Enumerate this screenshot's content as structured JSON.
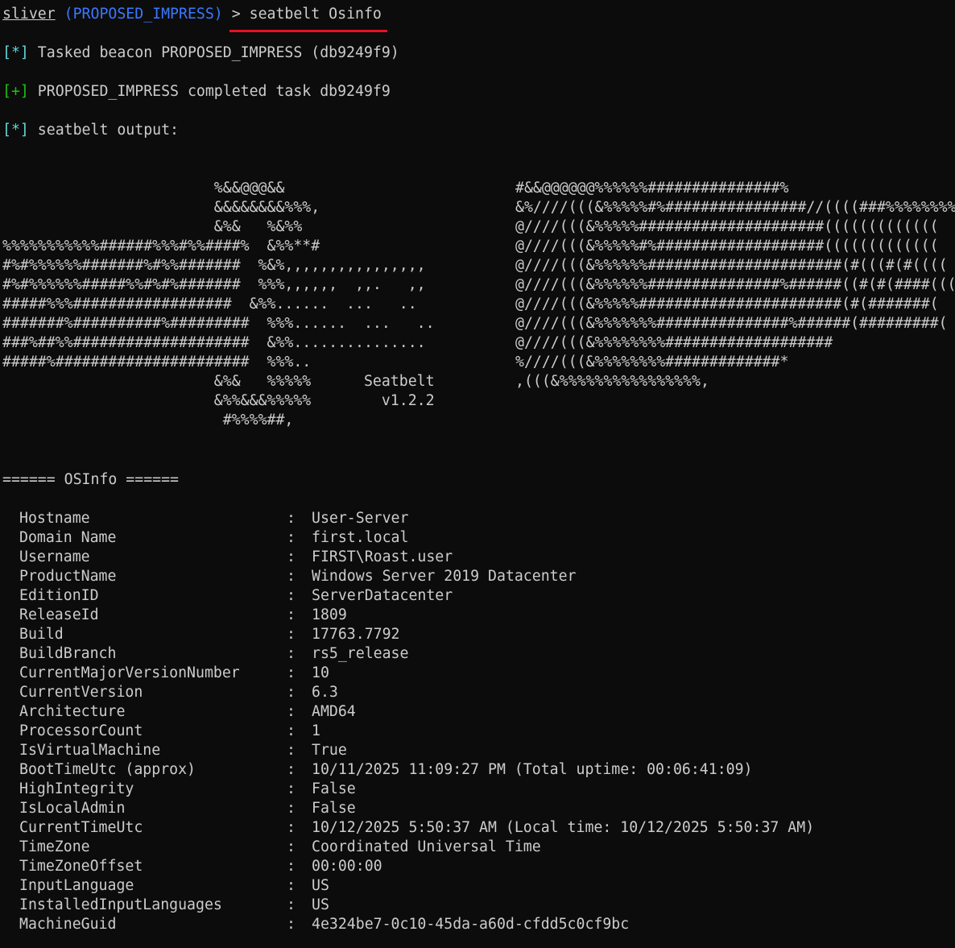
{
  "prompt": {
    "name": "sliver",
    "session": "(PROPOSED_IMPRESS)",
    "arrow": " > ",
    "command": "seatbelt Osinfo"
  },
  "messages": [
    {
      "marker": "[*]",
      "type": "info",
      "text": " Tasked beacon PROPOSED_IMPRESS (db9249f9)"
    },
    {
      "marker": "[+]",
      "type": "ok",
      "text": " PROPOSED_IMPRESS completed task db9249f9"
    },
    {
      "marker": "[*]",
      "type": "info",
      "text": " seatbelt output:"
    }
  ],
  "art": {
    "left_lines": [
      "                        %&&@@@&&",
      "                        &&&&&&&&%%%,",
      "                        &%&   %&%%",
      "%%%%%%%%%%%######%%%#%%####%  &%%**#",
      "#%#%%%%%%#######%#%%#######  %&%,,,,,,,,,,,,,,,,",
      "#%#%%%%%%#####%%#%#%#######  %%%,,,,,,  ,,.   ,,",
      "#####%%%##################  &%%......  ...   ..",
      "#######%##########%#########  %%%......  ...   ..",
      "###%##%%####################  &%%...............",
      "#####%######################  %%%..",
      "                        &%&   %%%%%      Seatbelt",
      "                        &%%&&&%%%%%        v1.2.2",
      "                         #%%%%##,"
    ],
    "right_lines": [
      "#&&@@@@@@%%%%%%###############%",
      "&%////(((&%%%%%#%################//((((###%%%%%%%%%%%",
      "@////(((&%%%%%#####################(((((((((((((",
      "@////(((&%%%%%#%###################(((((((((((((",
      "@////(((&%%%%%%######################(#(((#(#((((",
      "@////(((&%%%%%%###############%######((#(#(####((((",
      "@////(((&%%%%%#######################(#(#######(",
      "@////(((&%%%%%%%###############%######(#########(",
      "@////(((&%%%%%%%%###################",
      "%////(((&%%%%%%%%#############*",
      ",(((&%%%%%%%%%%%%%%%%,"
    ]
  },
  "section": {
    "title": "====== OSInfo ======"
  },
  "osinfo": [
    {
      "key": "Hostname",
      "value": "User-Server"
    },
    {
      "key": "Domain Name",
      "value": "first.local"
    },
    {
      "key": "Username",
      "value": "FIRST\\Roast.user"
    },
    {
      "key": "ProductName",
      "value": "Windows Server 2019 Datacenter"
    },
    {
      "key": "EditionID",
      "value": "ServerDatacenter"
    },
    {
      "key": "ReleaseId",
      "value": "1809"
    },
    {
      "key": "Build",
      "value": "17763.7792"
    },
    {
      "key": "BuildBranch",
      "value": "rs5_release"
    },
    {
      "key": "CurrentMajorVersionNumber",
      "value": "10"
    },
    {
      "key": "CurrentVersion",
      "value": "6.3"
    },
    {
      "key": "Architecture",
      "value": "AMD64"
    },
    {
      "key": "ProcessorCount",
      "value": "1"
    },
    {
      "key": "IsVirtualMachine",
      "value": "True"
    },
    {
      "key": "BootTimeUtc (approx)",
      "value": "10/11/2025 11:09:27 PM (Total uptime: 00:06:41:09)"
    },
    {
      "key": "HighIntegrity",
      "value": "False"
    },
    {
      "key": "IsLocalAdmin",
      "value": "False"
    },
    {
      "key": "CurrentTimeUtc",
      "value": "10/12/2025 5:50:37 AM (Local time: 10/12/2025 5:50:37 AM)"
    },
    {
      "key": "TimeZone",
      "value": "Coordinated Universal Time"
    },
    {
      "key": "TimeZoneOffset",
      "value": "00:00:00"
    },
    {
      "key": "InputLanguage",
      "value": "US"
    },
    {
      "key": "InstalledInputLanguages",
      "value": "US"
    },
    {
      "key": "MachineGuid",
      "value": "4e324be7-0c10-45da-a60d-cfdd5c0cf9bc"
    }
  ],
  "separator": ":",
  "colors": {
    "background": "#0c0c0c",
    "text": "#cccccc",
    "session": "#3b78ff",
    "info_marker": "#61d6d6",
    "ok_marker": "#16c60c",
    "command_underline": "#e81123"
  }
}
